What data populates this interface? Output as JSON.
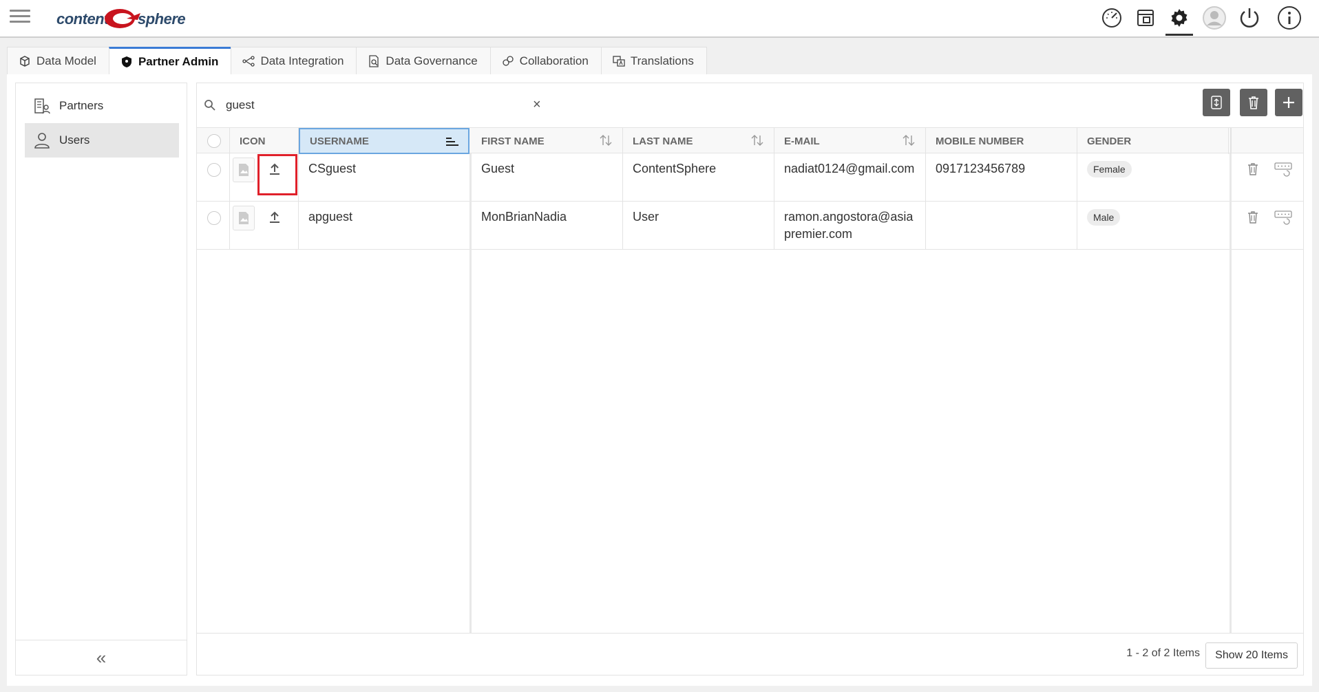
{
  "app": {
    "logo_left": "content",
    "logo_right": "sphere"
  },
  "topbar_icons": [
    "dashboard-icon",
    "widget-icon",
    "settings-gear-icon",
    "user-avatar-icon",
    "power-icon",
    "info-icon"
  ],
  "tabs": [
    {
      "label": "Data Model",
      "icon": "data-model-icon"
    },
    {
      "label": "Partner Admin",
      "icon": "shield-icon",
      "active": true
    },
    {
      "label": "Data Integration",
      "icon": "integration-icon"
    },
    {
      "label": "Data Governance",
      "icon": "governance-icon"
    },
    {
      "label": "Collaboration",
      "icon": "collaboration-icon"
    },
    {
      "label": "Translations",
      "icon": "translations-icon"
    }
  ],
  "sidebar": {
    "items": [
      {
        "label": "Partners",
        "icon": "partners-icon"
      },
      {
        "label": "Users",
        "icon": "user-icon",
        "selected": true
      }
    ],
    "collapse": "«"
  },
  "search": {
    "value": "guest",
    "clear": "×"
  },
  "table": {
    "headers": {
      "icon": "ICON",
      "username": "USERNAME",
      "first_name": "FIRST NAME",
      "last_name": "LAST NAME",
      "email": "E-MAIL",
      "mobile": "MOBILE NUMBER",
      "gender": "GENDER"
    },
    "rows": [
      {
        "username": "CSguest",
        "first_name": "Guest",
        "last_name": "ContentSphere",
        "email": "nadiat0124@gmail.com",
        "mobile": "0917123456789",
        "gender": "Female"
      },
      {
        "username": "apguest",
        "first_name": "MonBrianNadia",
        "last_name": "User",
        "email": "ramon.angostora@asiapremier.com",
        "mobile": "",
        "gender": "Male"
      }
    ]
  },
  "footer": {
    "page_info": "1 - 2 of 2 Items",
    "show_button": "Show 20 Items"
  },
  "colors": {
    "accent": "#3a7bd5",
    "highlight_header": "#d6e8f7",
    "action_button": "#616161",
    "annotation_red": "#e0202a",
    "logo_red": "#c8141e",
    "logo_blue": "#2d4a6b"
  }
}
